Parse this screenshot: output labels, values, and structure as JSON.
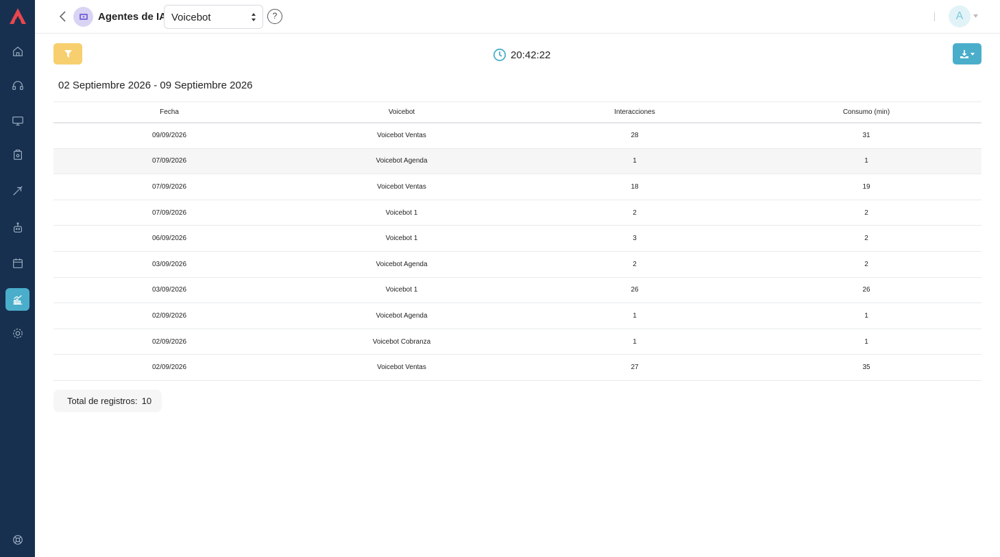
{
  "colors": {
    "sidebar": "#17304f",
    "active": "#4aaecb",
    "filter": "#f7cf6e",
    "download": "#4aaecb",
    "logo": "#e8464d"
  },
  "sidebar": {
    "items": [
      {
        "icon": "home-icon"
      },
      {
        "icon": "headset-icon"
      },
      {
        "icon": "monitor-icon"
      },
      {
        "icon": "bag-icon"
      },
      {
        "icon": "rocket-icon"
      },
      {
        "icon": "robot-icon"
      },
      {
        "icon": "calendar-icon"
      },
      {
        "icon": "chart-icon",
        "active": true
      },
      {
        "icon": "settings-icon"
      },
      {
        "icon": "support-icon"
      }
    ]
  },
  "header": {
    "title": "Agentes de IA:",
    "select_value": "Voicebot",
    "help": "?",
    "avatar": "A"
  },
  "toolbar": {
    "time": "20:42:22"
  },
  "date_range": "02 Septiembre 2026 - 09 Septiembre 2026",
  "table": {
    "headers": [
      "Fecha",
      "Voicebot",
      "Interacciones",
      "Consumo (min)"
    ],
    "rows": [
      [
        "09/09/2026",
        "Voicebot Ventas",
        "28",
        "31"
      ],
      [
        "07/09/2026",
        "Voicebot Agenda",
        "1",
        "1"
      ],
      [
        "07/09/2026",
        "Voicebot Ventas",
        "18",
        "19"
      ],
      [
        "07/09/2026",
        "Voicebot 1",
        "2",
        "2"
      ],
      [
        "06/09/2026",
        "Voicebot 1",
        "3",
        "2"
      ],
      [
        "03/09/2026",
        "Voicebot Agenda",
        "2",
        "2"
      ],
      [
        "03/09/2026",
        "Voicebot 1",
        "26",
        "26"
      ],
      [
        "02/09/2026",
        "Voicebot Agenda",
        "1",
        "1"
      ],
      [
        "02/09/2026",
        "Voicebot Cobranza",
        "1",
        "1"
      ],
      [
        "02/09/2026",
        "Voicebot Ventas",
        "27",
        "35"
      ]
    ]
  },
  "total": {
    "label": "Total de registros:",
    "value": "10"
  }
}
